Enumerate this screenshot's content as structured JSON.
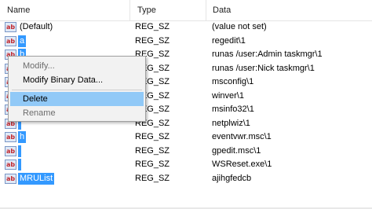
{
  "columns": {
    "name": "Name",
    "type": "Type",
    "data": "Data"
  },
  "rows": [
    {
      "icon": "ab",
      "name": "(Default)",
      "type": "REG_SZ",
      "data": "(value not set)"
    },
    {
      "icon": "ab",
      "name": "a",
      "type": "REG_SZ",
      "data": "regedit\\1"
    },
    {
      "icon": "ab",
      "name": "b",
      "type": "REG_SZ",
      "data": "runas /user:Admin taskmgr\\1"
    },
    {
      "icon": "ab",
      "name": "",
      "type": "REG_SZ",
      "data": "runas /user:Nick taskmgr\\1"
    },
    {
      "icon": "ab",
      "name": "",
      "type": "REG_SZ",
      "data": "msconfig\\1"
    },
    {
      "icon": "ab",
      "name": "",
      "type": "REG_SZ",
      "data": "winver\\1"
    },
    {
      "icon": "ab",
      "name": "",
      "type": "REG_SZ",
      "data": "msinfo32\\1"
    },
    {
      "icon": "ab",
      "name": "",
      "type": "REG_SZ",
      "data": "netplwiz\\1"
    },
    {
      "icon": "ab",
      "name": "h",
      "type": "REG_SZ",
      "data": "eventvwr.msc\\1"
    },
    {
      "icon": "ab",
      "name": "",
      "type": "REG_SZ",
      "data": "gpedit.msc\\1"
    },
    {
      "icon": "ab",
      "name": "",
      "type": "REG_SZ",
      "data": "WSReset.exe\\1"
    },
    {
      "icon": "ab",
      "name": "MRUList",
      "type": "REG_SZ",
      "data": "ajihgfedcb"
    }
  ],
  "context_menu": {
    "items": [
      {
        "label": "Modify...",
        "disabled": true,
        "highlighted": false
      },
      {
        "label": "Modify Binary Data...",
        "disabled": false,
        "highlighted": false
      },
      {
        "label": "Delete",
        "disabled": false,
        "highlighted": true
      },
      {
        "label": "Rename",
        "disabled": true,
        "highlighted": false
      }
    ]
  },
  "colors": {
    "selection": "#3399ff",
    "menu_highlight": "#91c9f7",
    "menu_bg": "#f2f2f2"
  }
}
